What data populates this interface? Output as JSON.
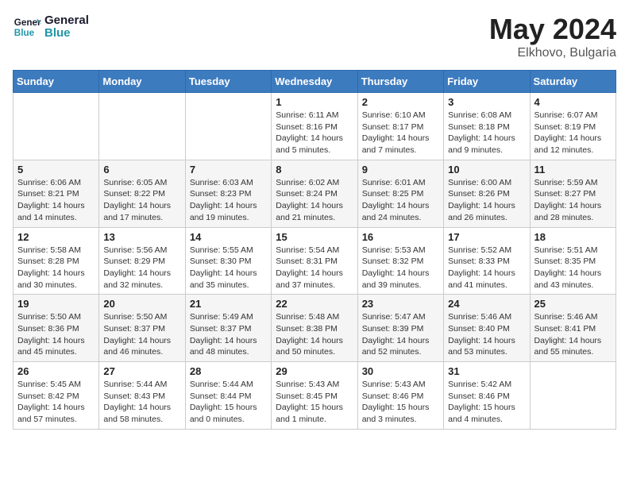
{
  "header": {
    "logo_general": "General",
    "logo_blue": "Blue",
    "month": "May 2024",
    "location": "Elkhovo, Bulgaria"
  },
  "days_of_week": [
    "Sunday",
    "Monday",
    "Tuesday",
    "Wednesday",
    "Thursday",
    "Friday",
    "Saturday"
  ],
  "weeks": [
    [
      {
        "day": "",
        "info": ""
      },
      {
        "day": "",
        "info": ""
      },
      {
        "day": "",
        "info": ""
      },
      {
        "day": "1",
        "info": "Sunrise: 6:11 AM\nSunset: 8:16 PM\nDaylight: 14 hours\nand 5 minutes."
      },
      {
        "day": "2",
        "info": "Sunrise: 6:10 AM\nSunset: 8:17 PM\nDaylight: 14 hours\nand 7 minutes."
      },
      {
        "day": "3",
        "info": "Sunrise: 6:08 AM\nSunset: 8:18 PM\nDaylight: 14 hours\nand 9 minutes."
      },
      {
        "day": "4",
        "info": "Sunrise: 6:07 AM\nSunset: 8:19 PM\nDaylight: 14 hours\nand 12 minutes."
      }
    ],
    [
      {
        "day": "5",
        "info": "Sunrise: 6:06 AM\nSunset: 8:21 PM\nDaylight: 14 hours\nand 14 minutes."
      },
      {
        "day": "6",
        "info": "Sunrise: 6:05 AM\nSunset: 8:22 PM\nDaylight: 14 hours\nand 17 minutes."
      },
      {
        "day": "7",
        "info": "Sunrise: 6:03 AM\nSunset: 8:23 PM\nDaylight: 14 hours\nand 19 minutes."
      },
      {
        "day": "8",
        "info": "Sunrise: 6:02 AM\nSunset: 8:24 PM\nDaylight: 14 hours\nand 21 minutes."
      },
      {
        "day": "9",
        "info": "Sunrise: 6:01 AM\nSunset: 8:25 PM\nDaylight: 14 hours\nand 24 minutes."
      },
      {
        "day": "10",
        "info": "Sunrise: 6:00 AM\nSunset: 8:26 PM\nDaylight: 14 hours\nand 26 minutes."
      },
      {
        "day": "11",
        "info": "Sunrise: 5:59 AM\nSunset: 8:27 PM\nDaylight: 14 hours\nand 28 minutes."
      }
    ],
    [
      {
        "day": "12",
        "info": "Sunrise: 5:58 AM\nSunset: 8:28 PM\nDaylight: 14 hours\nand 30 minutes."
      },
      {
        "day": "13",
        "info": "Sunrise: 5:56 AM\nSunset: 8:29 PM\nDaylight: 14 hours\nand 32 minutes."
      },
      {
        "day": "14",
        "info": "Sunrise: 5:55 AM\nSunset: 8:30 PM\nDaylight: 14 hours\nand 35 minutes."
      },
      {
        "day": "15",
        "info": "Sunrise: 5:54 AM\nSunset: 8:31 PM\nDaylight: 14 hours\nand 37 minutes."
      },
      {
        "day": "16",
        "info": "Sunrise: 5:53 AM\nSunset: 8:32 PM\nDaylight: 14 hours\nand 39 minutes."
      },
      {
        "day": "17",
        "info": "Sunrise: 5:52 AM\nSunset: 8:33 PM\nDaylight: 14 hours\nand 41 minutes."
      },
      {
        "day": "18",
        "info": "Sunrise: 5:51 AM\nSunset: 8:35 PM\nDaylight: 14 hours\nand 43 minutes."
      }
    ],
    [
      {
        "day": "19",
        "info": "Sunrise: 5:50 AM\nSunset: 8:36 PM\nDaylight: 14 hours\nand 45 minutes."
      },
      {
        "day": "20",
        "info": "Sunrise: 5:50 AM\nSunset: 8:37 PM\nDaylight: 14 hours\nand 46 minutes."
      },
      {
        "day": "21",
        "info": "Sunrise: 5:49 AM\nSunset: 8:37 PM\nDaylight: 14 hours\nand 48 minutes."
      },
      {
        "day": "22",
        "info": "Sunrise: 5:48 AM\nSunset: 8:38 PM\nDaylight: 14 hours\nand 50 minutes."
      },
      {
        "day": "23",
        "info": "Sunrise: 5:47 AM\nSunset: 8:39 PM\nDaylight: 14 hours\nand 52 minutes."
      },
      {
        "day": "24",
        "info": "Sunrise: 5:46 AM\nSunset: 8:40 PM\nDaylight: 14 hours\nand 53 minutes."
      },
      {
        "day": "25",
        "info": "Sunrise: 5:46 AM\nSunset: 8:41 PM\nDaylight: 14 hours\nand 55 minutes."
      }
    ],
    [
      {
        "day": "26",
        "info": "Sunrise: 5:45 AM\nSunset: 8:42 PM\nDaylight: 14 hours\nand 57 minutes."
      },
      {
        "day": "27",
        "info": "Sunrise: 5:44 AM\nSunset: 8:43 PM\nDaylight: 14 hours\nand 58 minutes."
      },
      {
        "day": "28",
        "info": "Sunrise: 5:44 AM\nSunset: 8:44 PM\nDaylight: 15 hours\nand 0 minutes."
      },
      {
        "day": "29",
        "info": "Sunrise: 5:43 AM\nSunset: 8:45 PM\nDaylight: 15 hours\nand 1 minute."
      },
      {
        "day": "30",
        "info": "Sunrise: 5:43 AM\nSunset: 8:46 PM\nDaylight: 15 hours\nand 3 minutes."
      },
      {
        "day": "31",
        "info": "Sunrise: 5:42 AM\nSunset: 8:46 PM\nDaylight: 15 hours\nand 4 minutes."
      },
      {
        "day": "",
        "info": ""
      }
    ]
  ]
}
